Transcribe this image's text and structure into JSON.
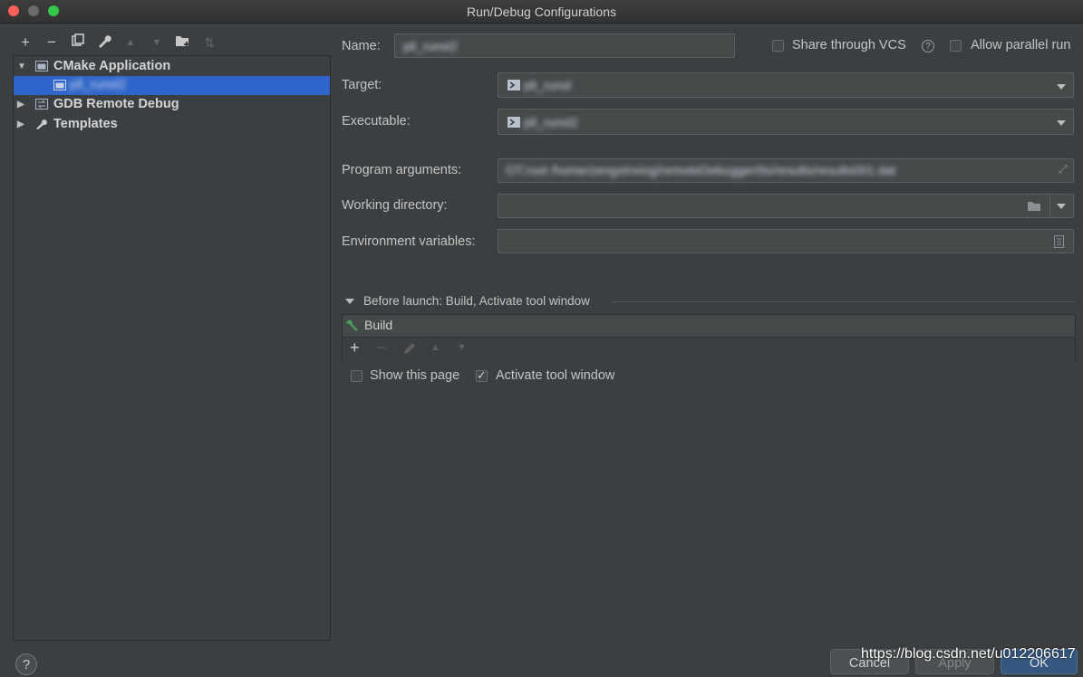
{
  "window": {
    "title": "Run/Debug Configurations"
  },
  "toolbar": {
    "add": "+",
    "remove": "−",
    "copy": "⧉",
    "edit_defaults": "🔧",
    "move_up": "▲",
    "move_down": "▼",
    "new_folder": "▆",
    "sort": "⇅"
  },
  "tree": {
    "items": [
      {
        "label": "CMake Application",
        "expanded": true
      },
      {
        "label": "pll_runsl2",
        "selected": true
      },
      {
        "label": "GDB Remote Debug",
        "expanded": false
      },
      {
        "label": "Templates",
        "expanded": false
      }
    ]
  },
  "form": {
    "name_label": "Name:",
    "name_value": "pll_runsl2",
    "share_vcs_label": "Share through VCS",
    "allow_parallel_label": "Allow parallel run",
    "target_label": "Target:",
    "target_value": "pll_runsl",
    "executable_label": "Executable:",
    "executable_value": "pll_runsl2",
    "program_args_label": "Program arguments:",
    "program_args_value": "OT.root /home/zengxinxing/remoteDebugger/tis/results/results001.dat",
    "working_dir_label": "Working directory:",
    "working_dir_value": "",
    "env_vars_label": "Environment variables:",
    "env_vars_value": ""
  },
  "before_launch": {
    "header": "Before launch: Build, Activate tool window",
    "items": [
      {
        "label": "Build"
      }
    ],
    "show_page_label": "Show this page",
    "show_page_checked": false,
    "activate_label": "Activate tool window",
    "activate_checked": true
  },
  "footer": {
    "help": "?",
    "cancel": "Cancel",
    "apply": "Apply",
    "ok": "OK",
    "watermark": "https://blog.csdn.net/u012206617"
  }
}
